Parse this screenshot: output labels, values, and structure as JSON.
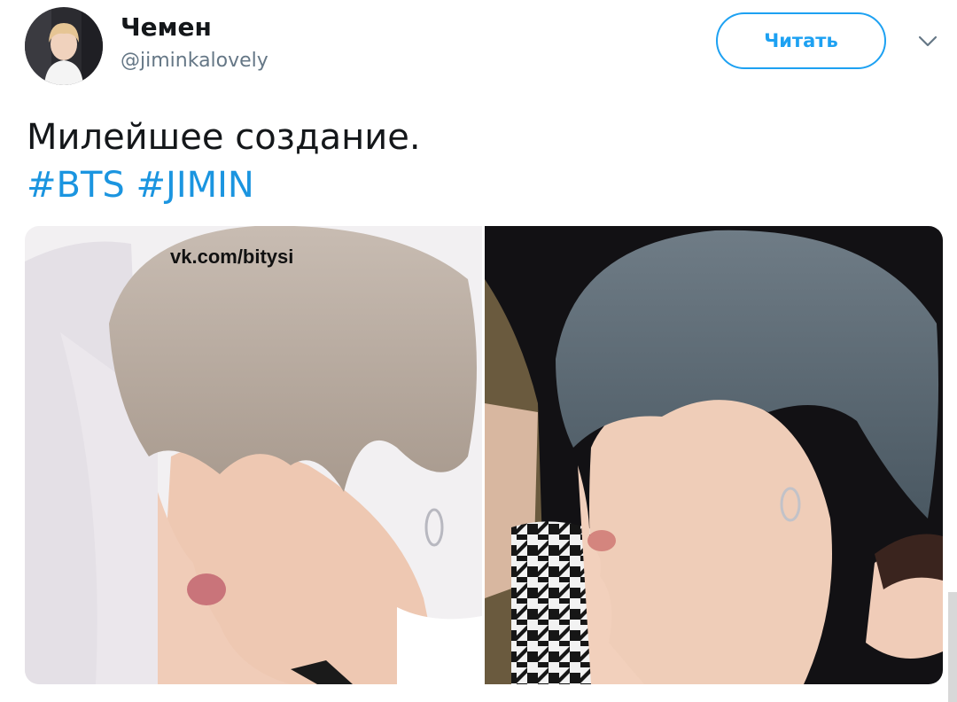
{
  "header": {
    "display_name": "Чемен",
    "handle": "@jiminkalovely",
    "follow_label": "Читать",
    "avatar_icon": "profile-photo",
    "menu_icon": "chevron-down-icon"
  },
  "tweet": {
    "text": "Милейшее создание.",
    "hashtags": [
      "#BTS",
      "#JIMIN"
    ]
  },
  "media": {
    "watermark": "vk.com/bitysi",
    "photos": [
      "left-photo",
      "right-photo"
    ]
  },
  "colors": {
    "accent": "#1da1f2",
    "hashtag": "#1b95e0",
    "text": "#14171a",
    "secondary": "#657786"
  }
}
